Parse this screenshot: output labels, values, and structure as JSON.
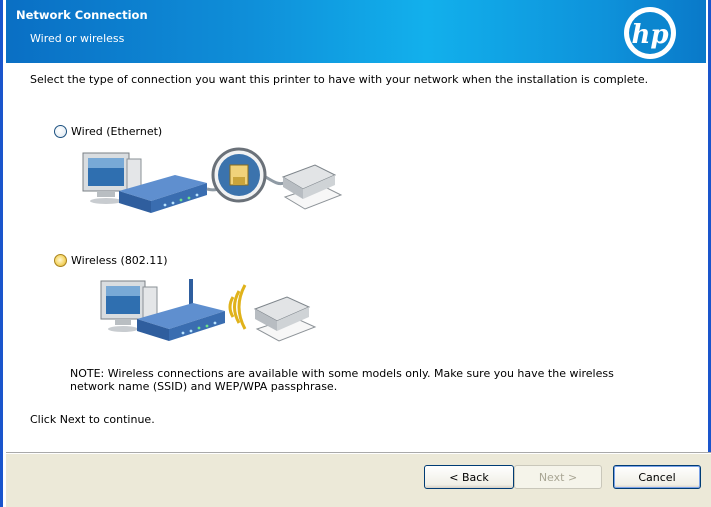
{
  "header": {
    "title": "Network Connection",
    "subtitle": "Wired or wireless",
    "logo_text": "hp"
  },
  "main": {
    "intro": "Select the type of connection you want this printer to have with your network when the installation is complete.",
    "options": [
      {
        "label": "Wired (Ethernet)",
        "selected": false
      },
      {
        "label": "Wireless (802.11)",
        "selected": false
      }
    ],
    "note": "NOTE: Wireless connections are available with some models only. Make sure you have the wireless network name (SSID) and WEP/WPA passphrase.",
    "continue_hint": "Click Next to continue."
  },
  "footer": {
    "back_label": "< Back",
    "next_label": "Next >",
    "cancel_label": "Cancel"
  },
  "colors": {
    "banner_start": "#0a6fc4",
    "banner_mid": "#12b0ec",
    "window_border": "#1a55cc",
    "button_bar": "#ece9d8"
  },
  "icons": [
    "hp-logo-icon",
    "computer-icon",
    "router-icon",
    "ethernet-jack-icon",
    "printer-icon",
    "wireless-signal-icon"
  ]
}
